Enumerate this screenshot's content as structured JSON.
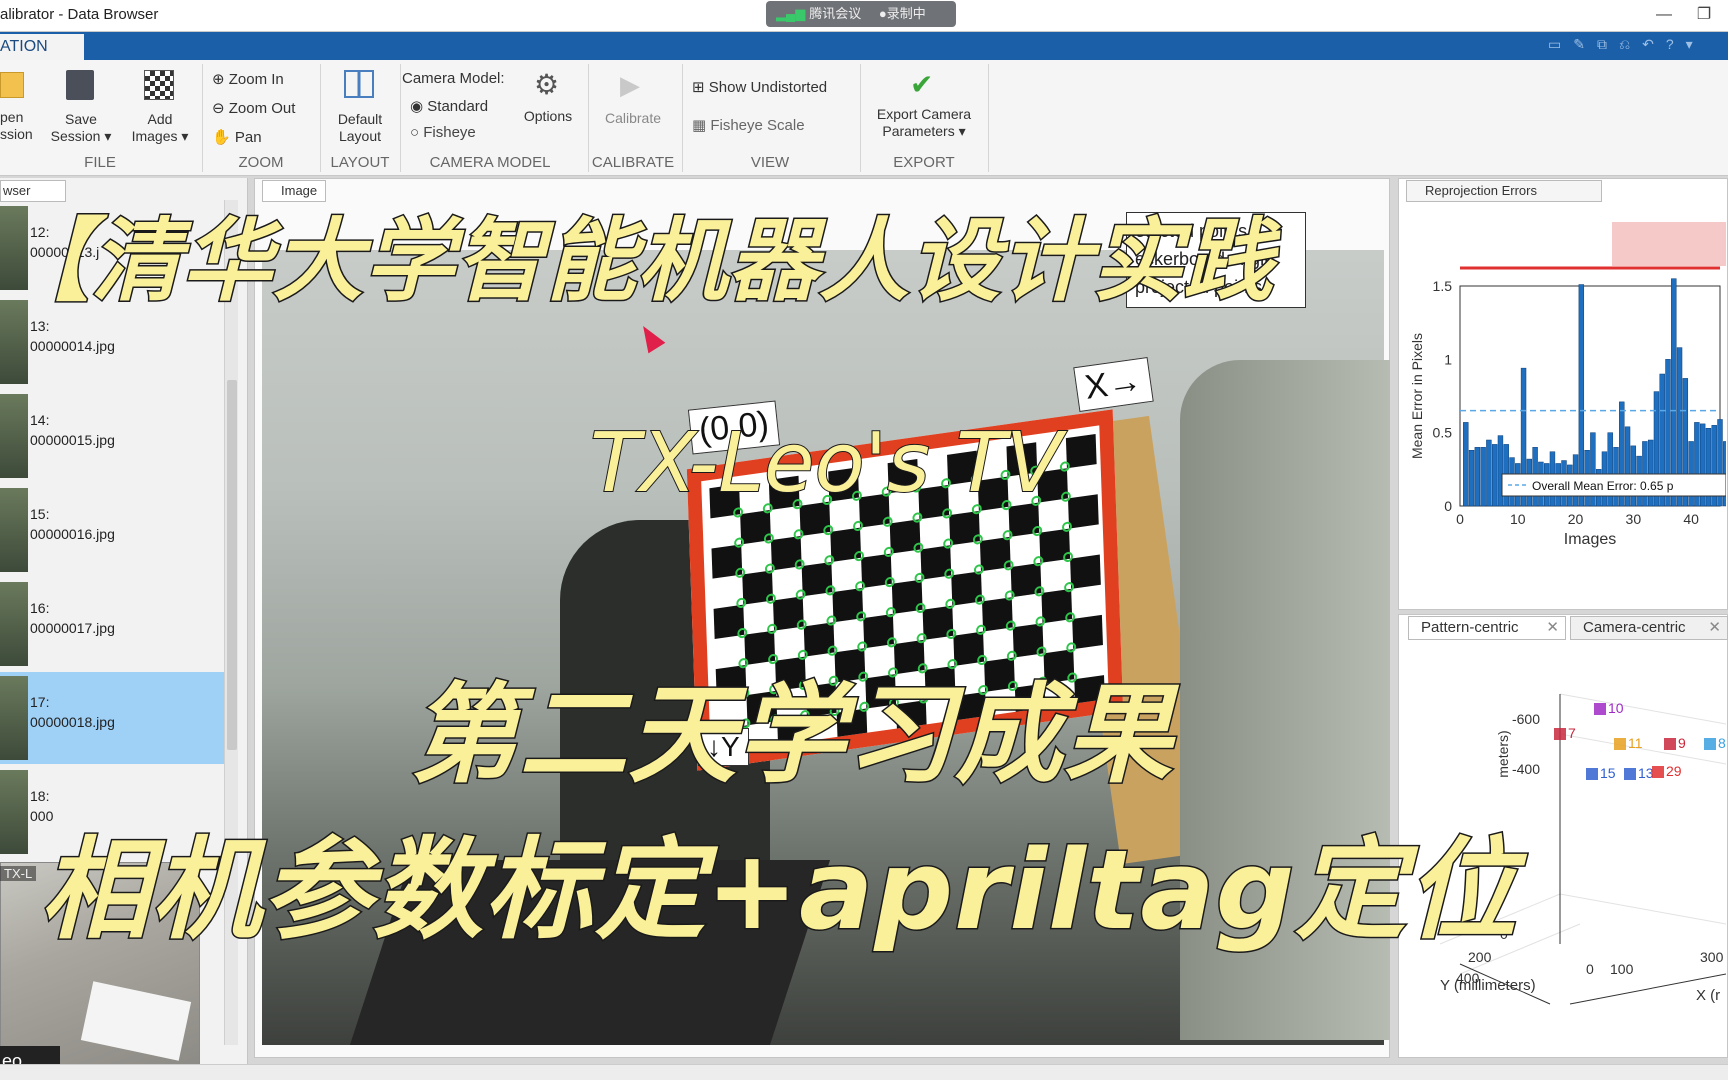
{
  "window": {
    "title": "alibrator - Data Browser",
    "meeting_app": "腾讯会议",
    "recording": "录制中",
    "minimize": "—",
    "restore": "❐"
  },
  "tabs": {
    "app": "ATION"
  },
  "ribbon": {
    "file": {
      "group": "FILE",
      "open": "pen\nssion",
      "save": "Save\nSession ▾",
      "add": "Add\nImages ▾"
    },
    "zoom": {
      "group": "ZOOM",
      "zoom_in": "Zoom In",
      "zoom_out": "Zoom Out",
      "pan": "Pan"
    },
    "layout": {
      "group": "LAYOUT",
      "default": "Default\nLayout"
    },
    "camera_model": {
      "group": "CAMERA MODEL",
      "label": "Camera Model:",
      "standard": "Standard",
      "fisheye": "Fisheye",
      "options": "Options"
    },
    "calibrate": {
      "group": "CALIBRATE",
      "button": "Calibrate"
    },
    "view": {
      "group": "VIEW",
      "show_undistorted": "Show Undistorted",
      "fisheye_scale": "Fisheye Scale"
    },
    "export": {
      "group": "EXPORT",
      "button": "Export Camera\nParameters ▾"
    }
  },
  "browser": {
    "tab": "wser",
    "items": [
      {
        "index": "12:",
        "file": "00000013.j"
      },
      {
        "index": "13:",
        "file": "00000014.jpg"
      },
      {
        "index": "14:",
        "file": "00000015.jpg"
      },
      {
        "index": "15:",
        "file": "00000016.jpg"
      },
      {
        "index": "16:",
        "file": "00000017.jpg"
      },
      {
        "index": "17:",
        "file": "00000018.jpg"
      },
      {
        "index": "18:",
        "file": "000"
      }
    ],
    "selected_index": 5
  },
  "webcam": {
    "label": "eo",
    "title": "TX-L"
  },
  "image_panel": {
    "tab": "Image",
    "origin_label": "(0,0)",
    "x_label": "X→",
    "y_label": "↓Y",
    "legend": [
      "etected points",
      "eckerboard origin",
      "projected points"
    ]
  },
  "reprojection": {
    "tab": "Reprojection Errors",
    "ylabel": "Mean Error in Pixels",
    "xlabel": "Images",
    "legend": "Overall Mean Error: 0.65 p",
    "xticks": [
      "0",
      "10",
      "20",
      "30",
      "40"
    ],
    "yticks": [
      "0",
      "0.5",
      "1",
      "1.5"
    ]
  },
  "extrinsics": {
    "tabs": [
      "Pattern-centric",
      "Camera-centric"
    ],
    "z_axis_label": "meters)",
    "y_axis_label": "Y (millimeters)",
    "x_axis_label": "X (r",
    "zticks": [
      "-600",
      "-400"
    ],
    "yticks": [
      "0",
      "200",
      "400"
    ],
    "xticks": [
      "0",
      "100",
      "300"
    ],
    "markers": [
      "10",
      "7",
      "11",
      "9",
      "8",
      "15",
      "13",
      "29"
    ]
  },
  "overlay": {
    "banner1": "【清华大学智能机器人设计实践",
    "watermark": "TX-Leo's TV",
    "banner2": "第二天学习成果",
    "banner3": "相机参数标定+apriltag定位"
  },
  "chart_data": {
    "type": "bar",
    "title": "",
    "xlabel": "Images",
    "ylabel": "Mean Error in Pixels",
    "xlim": [
      0,
      45
    ],
    "ylim": [
      0,
      1.5
    ],
    "mean_line": 0.65,
    "values": [
      0.57,
      0.38,
      0.4,
      0.4,
      0.45,
      0.42,
      0.48,
      0.42,
      0.33,
      0.29,
      0.94,
      0.32,
      0.4,
      0.3,
      0.29,
      0.37,
      0.29,
      0.31,
      0.28,
      0.35,
      1.51,
      0.38,
      0.5,
      0.25,
      0.37,
      0.5,
      0.4,
      0.71,
      0.54,
      0.41,
      0.34,
      0.44,
      0.45,
      0.78,
      0.9,
      1.0,
      1.55,
      1.08,
      0.87,
      0.44,
      0.57,
      0.56,
      0.53,
      0.55,
      0.59,
      0.44,
      0.74,
      0.53,
      0.41
    ],
    "colors": {
      "bar": "#1f6fc0",
      "mean": "#5aa9e6",
      "accent": "#e03030"
    }
  },
  "colors": {
    "ribbon_tab": "#1a5fa8",
    "selection": "#9fd0f6",
    "banner_text": "#fbf09a"
  }
}
